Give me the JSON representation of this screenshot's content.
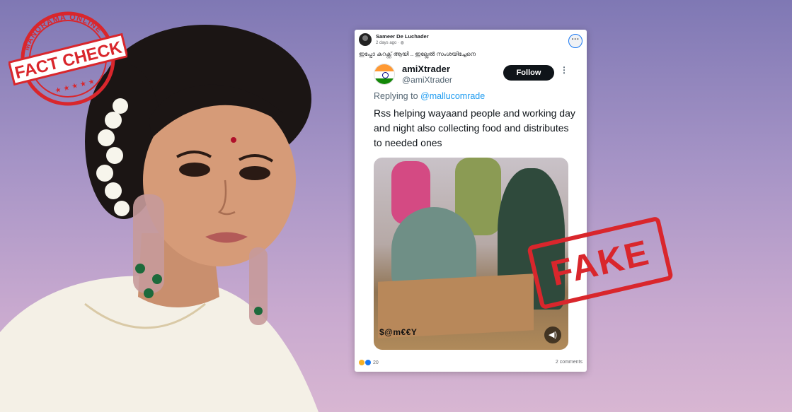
{
  "stamp": {
    "arc_text": "MANORAMA ONLINE",
    "banner_text": "FACT CHECK",
    "color": "#d9262c"
  },
  "post": {
    "author": "Sameer De Luchader",
    "meta": "2 days ago · ",
    "caption": "ഇപ്പോ കറക്റ്റ് ആയി .. ഇല്ലേൽ സംശയിച്ചേനെ",
    "more_icon": "ellipsis-icon",
    "reactions_count": "20",
    "comments": "2 comments"
  },
  "tweet": {
    "name": "amiXtrader",
    "handle": "@amiXtrader",
    "follow_label": "Follow",
    "more_glyph": "⋮",
    "reply_prefix": "Replying to ",
    "reply_mention": "@mallucomrade",
    "text": "Rss helping wayaand people and working day and night also collecting food and distributes to needed ones",
    "watermark": "$@m€€Y",
    "volume_icon": "speaker-icon"
  },
  "verdict": {
    "label": "FAKE",
    "color": "#d9262c"
  }
}
